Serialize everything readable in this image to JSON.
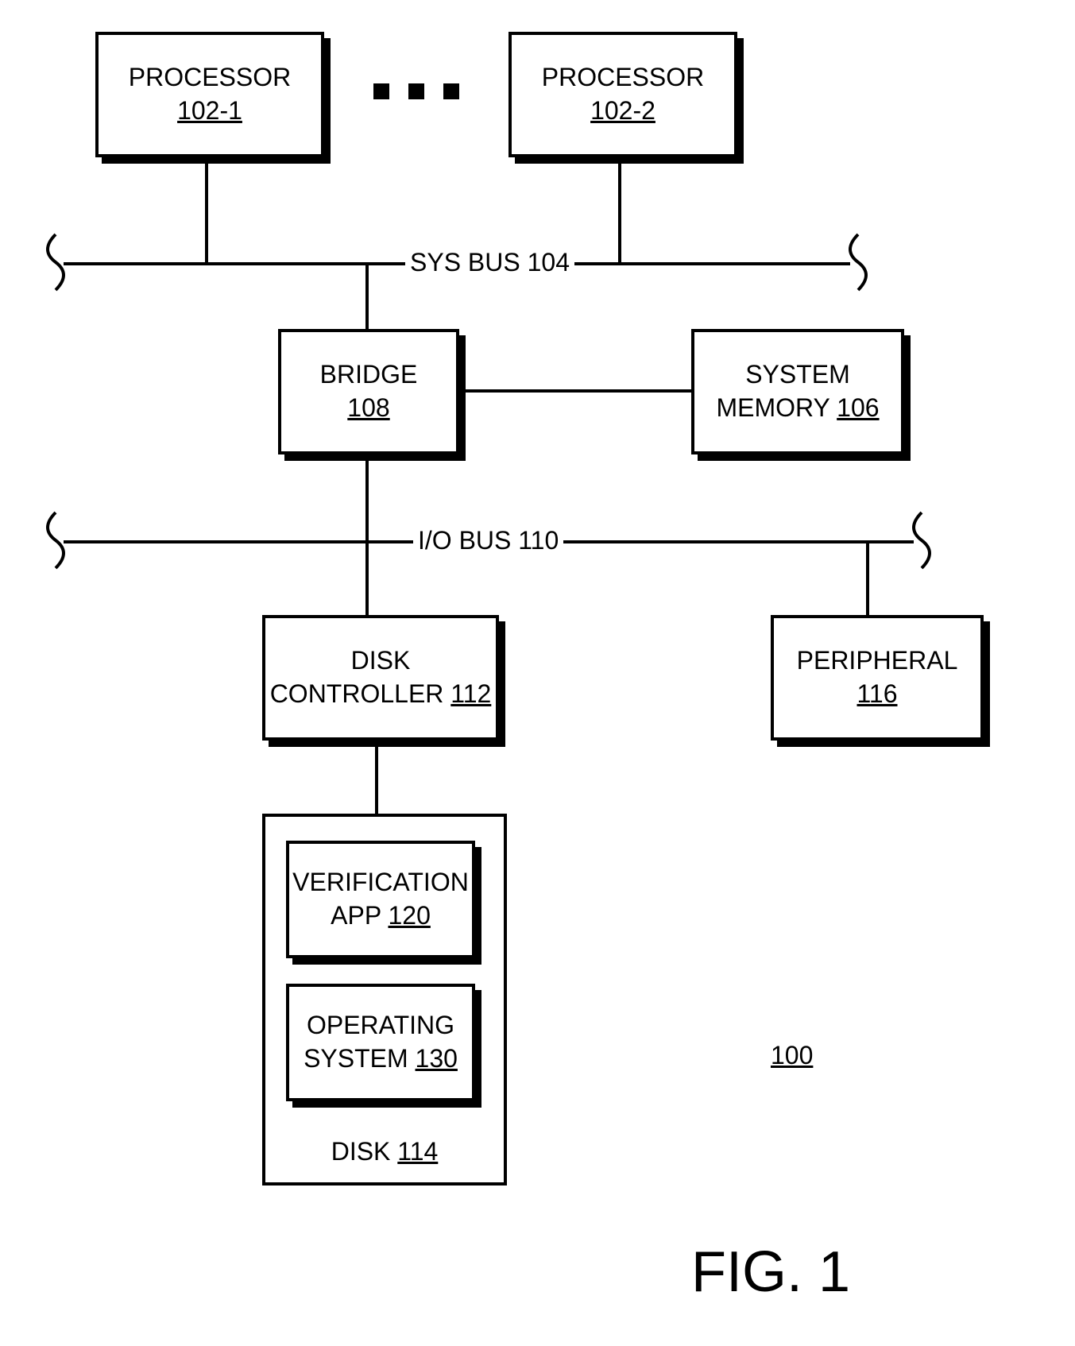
{
  "blocks": {
    "processor1": {
      "label": "PROCESSOR",
      "ref": "102-1"
    },
    "processor2": {
      "label": "PROCESSOR",
      "ref": "102-2"
    },
    "bridge": {
      "label": "BRIDGE",
      "ref": "108"
    },
    "system_memory": {
      "line1": "SYSTEM",
      "line2": "MEMORY",
      "ref": "106"
    },
    "disk_controller": {
      "line1": "DISK",
      "line2": "CONTROLLER",
      "ref": "112"
    },
    "peripheral": {
      "label": "PERIPHERAL",
      "ref": "116"
    },
    "verification_app": {
      "line1": "VERIFICATION",
      "line2": "APP",
      "ref": "120"
    },
    "operating_system": {
      "line1": "OPERATING",
      "line2": "SYSTEM",
      "ref": "130"
    },
    "disk": {
      "label": "DISK",
      "ref": "114"
    }
  },
  "buses": {
    "sys_bus": "SYS BUS 104",
    "io_bus": "I/O BUS 110"
  },
  "figure": {
    "ref": "100",
    "caption": "FIG. 1"
  }
}
